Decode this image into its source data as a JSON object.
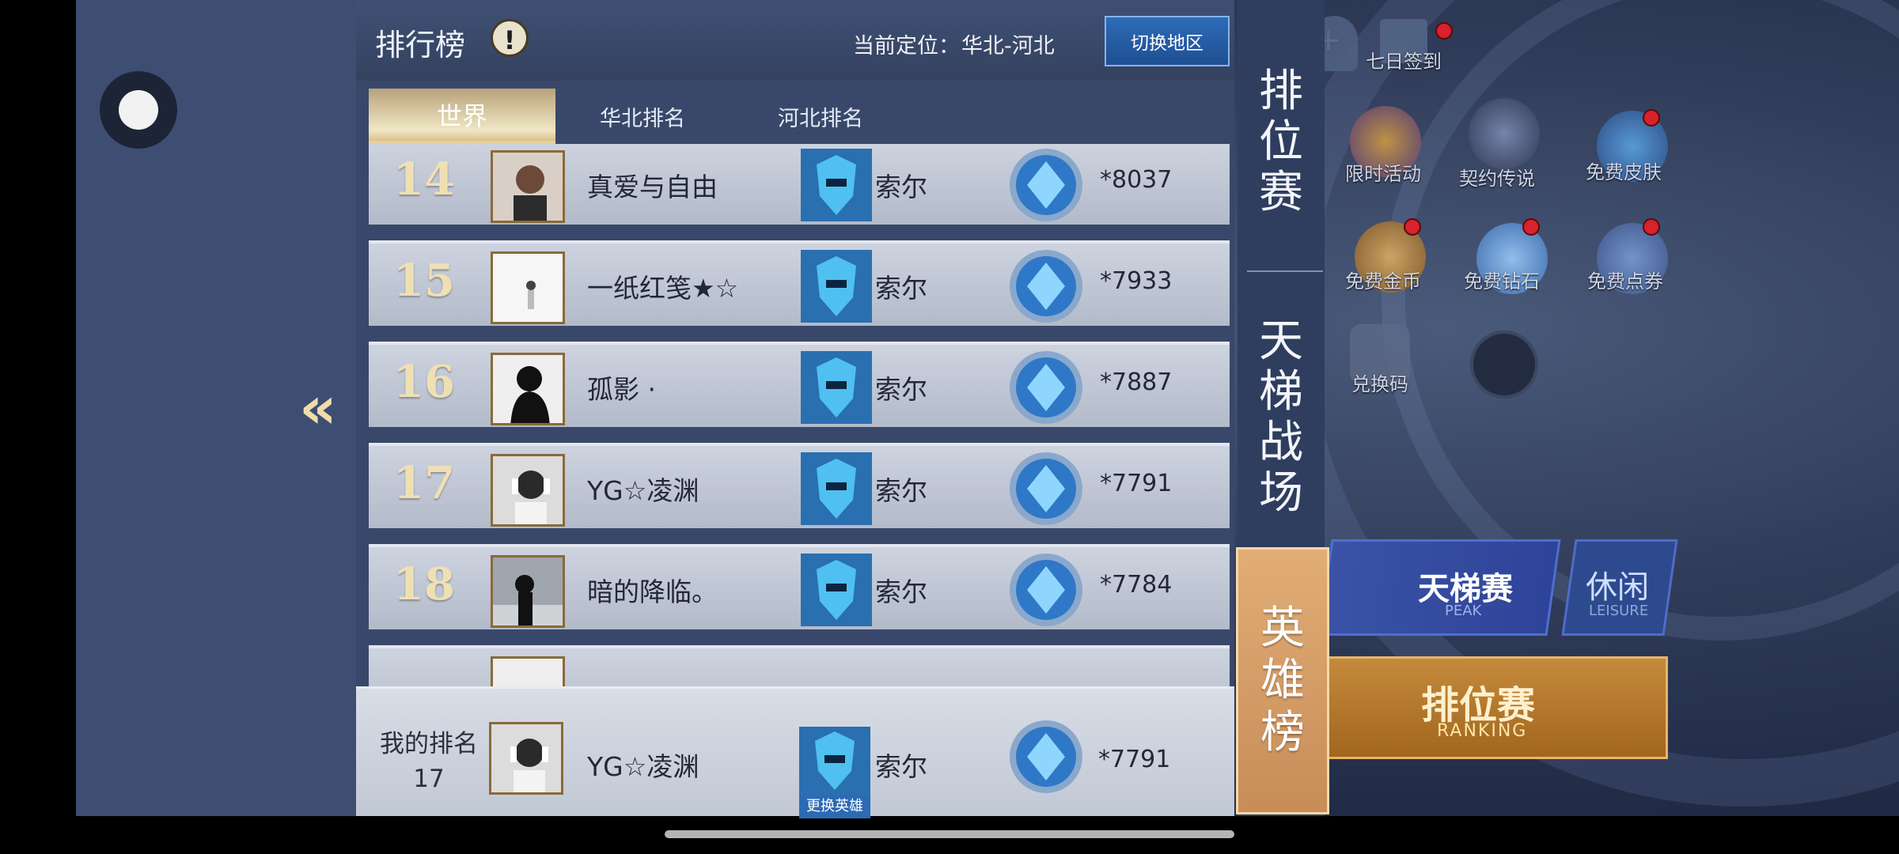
{
  "panel": {
    "title": "排行榜",
    "info_icon": "!",
    "location_label": "当前定位：",
    "location_value": "华北-河北",
    "switch_region": "切换地区"
  },
  "tabs": [
    {
      "label": "世界",
      "active": true
    },
    {
      "label": "华北排名",
      "active": false
    },
    {
      "label": "河北排名",
      "active": false
    }
  ],
  "rows": [
    {
      "rank": "14",
      "name": "真爱与自由",
      "hero": "索尔",
      "score": "*8037"
    },
    {
      "rank": "15",
      "name": "一纸红笺★☆",
      "hero": "索尔",
      "score": "*7933"
    },
    {
      "rank": "16",
      "name": "孤影 ·",
      "hero": "索尔",
      "score": "*7887"
    },
    {
      "rank": "17",
      "name": "YG☆凌渊",
      "hero": "索尔",
      "score": "*7791"
    },
    {
      "rank": "18",
      "name": "暗的降临。",
      "hero": "索尔",
      "score": "*7784"
    }
  ],
  "my_rank": {
    "label_line1": "我的排名",
    "label_line2": "17",
    "name": "YG☆凌渊",
    "hero": "索尔",
    "score": "*7791",
    "change_hero": "更换英雄"
  },
  "categories": {
    "ranked": [
      "排",
      "位",
      "赛"
    ],
    "ladder": [
      "天",
      "梯",
      "战",
      "场"
    ],
    "heroes": [
      "英",
      "雄",
      "榜"
    ]
  },
  "background": {
    "checkin": "七日签到",
    "limited": "限时活动",
    "legend": "契约传说",
    "free_skin": "免费皮肤",
    "free_gold": "免费金币",
    "free_diamond": "免费钻石",
    "free_coupon": "免费点券",
    "redeem": "兑换码",
    "peak_title": "天梯赛",
    "peak_sub": "PEAK",
    "leisure_title": "休闲",
    "leisure_sub": "LEISURE",
    "ranking_title": "排位赛",
    "ranking_sub": "RANKING"
  },
  "colors": {
    "panel_bg": "#39486a",
    "row_bg": "#c1c7d4",
    "rank_gold": "#efe0b4",
    "heroes_tab": "#d69c66",
    "switch_button": "#2a5fa8"
  }
}
